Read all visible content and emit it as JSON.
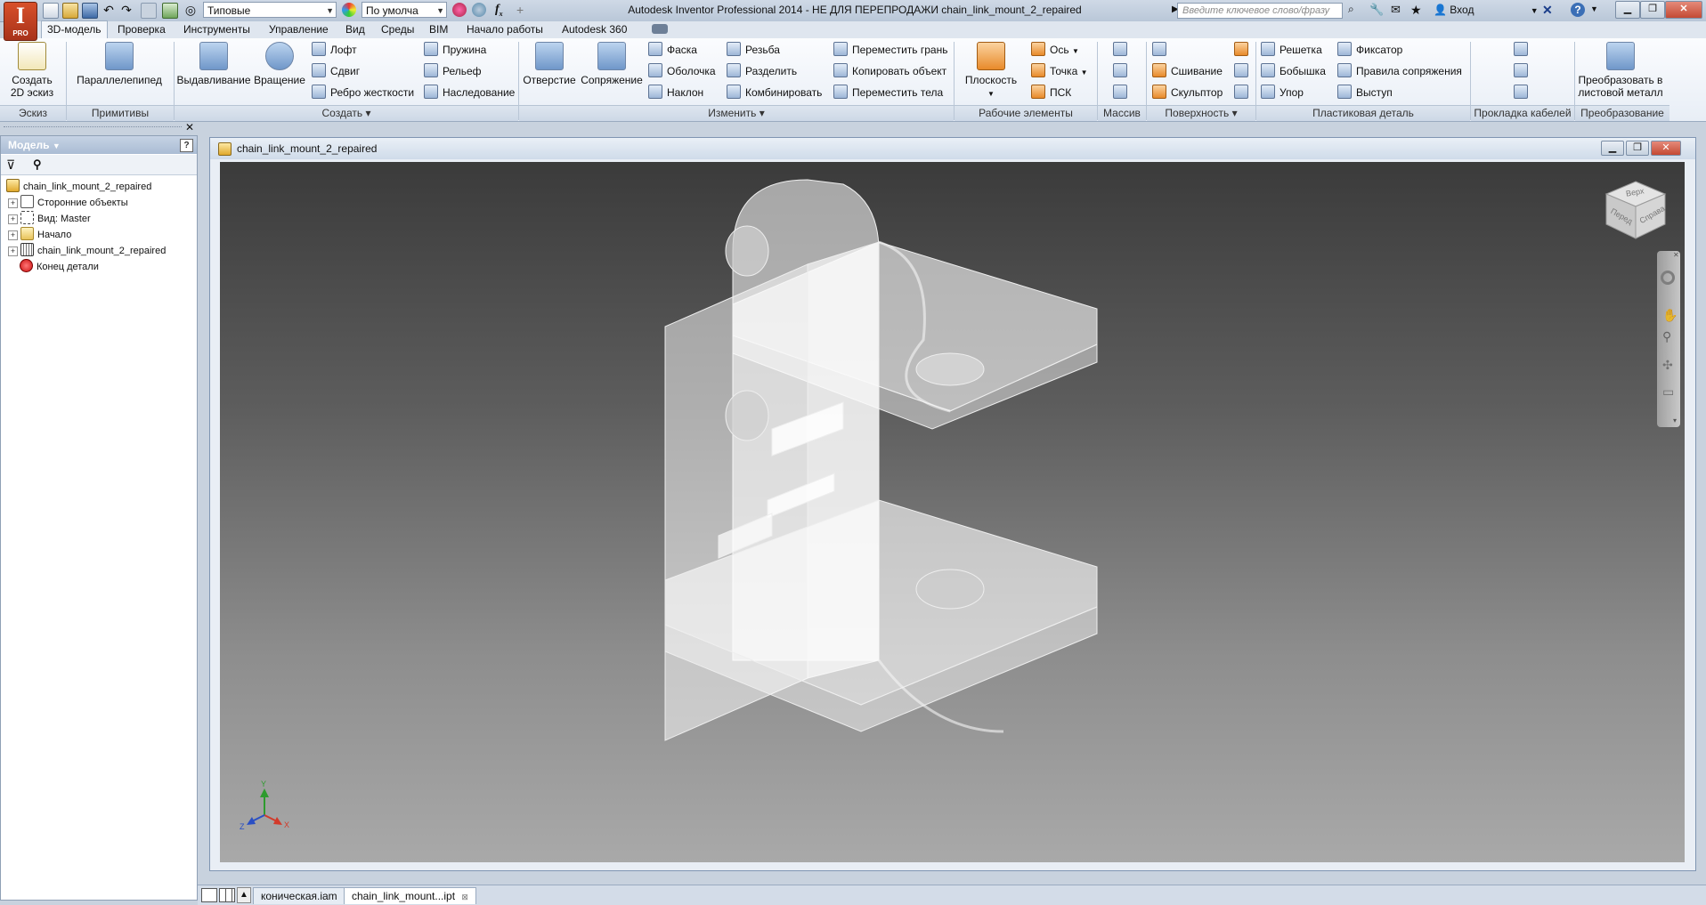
{
  "app": {
    "title": "Autodesk Inventor Professional 2014 - НЕ ДЛЯ ПЕРЕПРОДАЖИ   chain_link_mount_2_repaired",
    "logo_letter": "I",
    "logo_sub": "PRO"
  },
  "qat": {
    "appearance_combo": "Типовые",
    "material_combo": "По умолча",
    "search_placeholder": "Введите ключевое слово/фразу",
    "signin": "Вход"
  },
  "tabs": [
    "3D-модель",
    "Проверка",
    "Инструменты",
    "Управление",
    "Вид",
    "Среды",
    "BIM",
    "Начало работы",
    "Autodesk 360"
  ],
  "ribbon": {
    "sketch": {
      "label": "Эскиз",
      "create_2d": "Создать\n2D эскиз"
    },
    "primitives": {
      "label": "Примитивы",
      "box": "Параллелепипед"
    },
    "create": {
      "label": "Создать",
      "extrude": "Выдавливание",
      "revolve": "Вращение",
      "loft": "Лофт",
      "sweep": "Сдвиг",
      "rib": "Ребро жесткости",
      "coil": "Пружина",
      "emboss": "Рельеф",
      "derive": "Наследование"
    },
    "modify": {
      "label": "Изменить",
      "hole": "Отверстие",
      "fillet": "Сопряжение",
      "chamfer": "Фаска",
      "shell": "Оболочка",
      "draft": "Наклон",
      "thread": "Резьба",
      "split": "Разделить",
      "combine": "Комбинировать",
      "move_face": "Переместить грань",
      "copy_object": "Копировать объект",
      "move_bodies": "Переместить тела"
    },
    "work_features": {
      "label": "Рабочие элементы",
      "plane": "Плоскость",
      "axis": "Ось",
      "point": "Точка",
      "ucs": "ПСК"
    },
    "pattern": {
      "label": "Массив"
    },
    "surface": {
      "label": "Поверхность",
      "stitch": "Сшивание",
      "sculpt": "Скульптор"
    },
    "plastic": {
      "label": "Пластиковая деталь",
      "grill": "Решетка",
      "boss": "Бобышка",
      "rest": "Упор",
      "snap_fit": "Фиксатор",
      "rule_fillet": "Правила сопряжения",
      "lip": "Выступ"
    },
    "cable": {
      "label": "Прокладка кабелей"
    },
    "convert": {
      "label": "Преобразование",
      "to_sheet": "Преобразовать в\nлистовой металл"
    }
  },
  "browser": {
    "header": "Модель",
    "items": [
      {
        "label": "chain_link_mount_2_repaired",
        "icon": "part-icon",
        "expander": ""
      },
      {
        "label": "Сторонние объекты",
        "icon": "third-party-icon",
        "expander": "+"
      },
      {
        "label": "Вид: Master",
        "icon": "view-icon",
        "expander": "+"
      },
      {
        "label": "Начало",
        "icon": "folder-icon",
        "expander": "+"
      },
      {
        "label": "chain_link_mount_2_repaired",
        "icon": "solid-body-icon",
        "expander": "+"
      },
      {
        "label": "Конец детали",
        "icon": "end-of-part-icon",
        "expander": ""
      }
    ]
  },
  "document": {
    "title": "chain_link_mount_2_repaired",
    "viewcube": {
      "top": "Верх",
      "front": "Перед",
      "right": "Справа"
    },
    "triad": {
      "x": "X",
      "y": "Y",
      "z": "Z"
    }
  },
  "doc_tabs": [
    {
      "label": "коническая.iam",
      "active": false
    },
    {
      "label": "chain_link_mount...ipt",
      "active": true
    }
  ],
  "colors": {
    "ribbon_bg": "#eef3f9",
    "accent_blue": "#3b6fb6",
    "close_red": "#c44a34"
  }
}
